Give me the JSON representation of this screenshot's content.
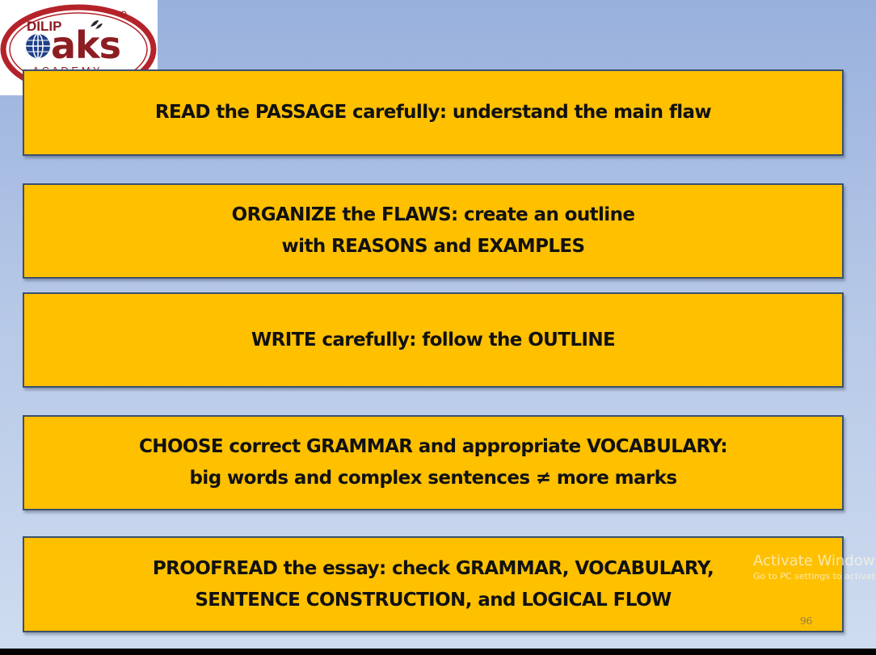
{
  "logo": {
    "top_text": "DILIP",
    "brand_text": "aks",
    "bottom_text": "A C A D E M Y",
    "colors": {
      "ring": "#b5232a",
      "text": "#8c1d22",
      "globe": "#1f3f8a"
    }
  },
  "boxes": [
    {
      "lines": [
        "READ the PASSAGE carefully: understand the main flaw"
      ]
    },
    {
      "lines": [
        "ORGANIZE the FLAWS: create an outline",
        "with REASONS and EXAMPLES"
      ]
    },
    {
      "lines": [
        "WRITE carefully: follow the OUTLINE"
      ]
    },
    {
      "lines": [
        "CHOOSE correct GRAMMAR and appropriate VOCABULARY:",
        "big words and complex sentences ≠ more marks"
      ]
    },
    {
      "lines": [
        "PROOFREAD the essay: check GRAMMAR, VOCABULARY,",
        "SENTENCE CONSTRUCTION, and LOGICAL FLOW"
      ]
    }
  ],
  "watermark": {
    "title": "Activate Windows",
    "subtitle": "Go to PC settings to activate Windows."
  },
  "slide_number": "96",
  "colors": {
    "box_fill": "#ffc000",
    "box_border": "#3a506e",
    "background_top": "#98b0dd",
    "background_bottom": "#cfdcf0"
  }
}
